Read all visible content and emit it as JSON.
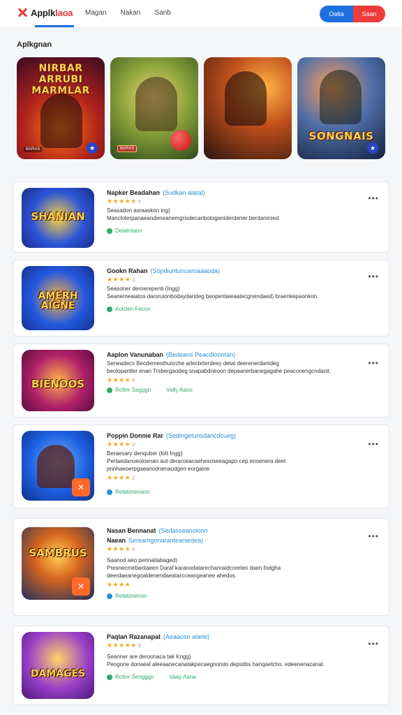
{
  "header": {
    "logo_text": "Applk",
    "logo_accent": "laoa",
    "nav": [
      "Magan",
      "Nakan",
      "Sanb"
    ],
    "btn_blue": "Oatia",
    "btn_red": "Saan"
  },
  "section": {
    "title": "Aplkgnan"
  },
  "banners": [
    {
      "title": "NIRBAR ARRUBI\nMARMLAR",
      "tag": "BARAS",
      "badge": "★"
    },
    {
      "title": "",
      "tag": "BARAS",
      "badge": ""
    },
    {
      "title": "",
      "tag": "",
      "badge": ""
    },
    {
      "title": "SONGNAIS",
      "tag": "",
      "badge": "★"
    }
  ],
  "apps": [
    {
      "icon_text": "SHANIAN",
      "title": "Napker Beadahan",
      "category": "(Sudkan alatal)",
      "rating": "5",
      "meta": "Seasadon asraaskon ing)",
      "desc": "Mancloterpanaeandeneanemgrisdecanbotoganiderdener berdaniroed",
      "status": "Delatntaon",
      "extra": ""
    },
    {
      "icon_text": "AMERH AIGNE",
      "title": "Gookn Rahan",
      "category": "(Sopdiuntunuaroaaaoda)",
      "rating": "3",
      "meta": "Seasoner deroerepenti (Ingg)",
      "desc": "Seanemeaiatos darsruionbodaydarideg beopentaieaatecgnendaed) braenkepaonkon.",
      "status": "Aoiclen Fecon",
      "extra": ""
    },
    {
      "icon_text": "BIENOOS",
      "title": "Aaplon Vanunaban",
      "category": "(Bedeans Peacdioontan)",
      "rating": "4",
      "meta": "Seneadecs Becdemesthuorche arlecbrterdeey detal deerenerdanideg",
      "desc": "beolopantler enan Trsbergaodeg snapabdneoon depaanerbanegagahe peaconengcndanit.",
      "status": "Rofinr Sagggn",
      "extra": "Vatly Aaoo"
    },
    {
      "icon_text": "",
      "title": "Poppin Donnie Rar",
      "category": "(Sedingetunsdancdcueg)",
      "rating": "3",
      "meta": "Beraesary denquber (lott Ingg)",
      "desc": "Pertaedanoeoloenan aut deraroeacaehesoseeagapo cep enoenera deet pnnhaeoerpgaeanodnenaodgen eorgaine",
      "status": "Relatonenaon",
      "extra": "",
      "rating2": "2"
    },
    {
      "icon_text": "SAMBRUS",
      "title": "Nasan Bennanat",
      "category": "(Sedasseanoioon",
      "rating": "4",
      "subtitle": "Naean",
      "subcategory": "Sereamgonaranteaniedea)",
      "meta": "Saanod aeo pennaitabaged)",
      "desc": "Presnecmebantaeen Daraf karanodatarechanraidcoreteo daen fodgha deerdaeanegoaldenendaeatarcceangeanee ahedos.",
      "status": "Relatonenoo",
      "extra": ""
    },
    {
      "icon_text": "DAMAGES",
      "title": "Paqlan Razanapat",
      "category": "(Aeaacon alarle)",
      "rating": "5",
      "meta": "Seanner are deroonaca tak Kngg)",
      "desc": "Peogone donaeal aleeaanecanatakpecaegnondo depstibs hanqaetcho. edeenenacanal.",
      "status": "Rofinr Sengggo",
      "extra": "Vaay Aana"
    }
  ],
  "colors": {
    "accent_blue": "#1e6fe0",
    "accent_red": "#ef3b3b",
    "category_blue": "#2a8fd8",
    "status_green": "#2fa96f",
    "star": "#f5a623"
  },
  "icons": [
    "more-dots-icon",
    "star-icon",
    "check-dot-icon",
    "logo-x-icon"
  ]
}
